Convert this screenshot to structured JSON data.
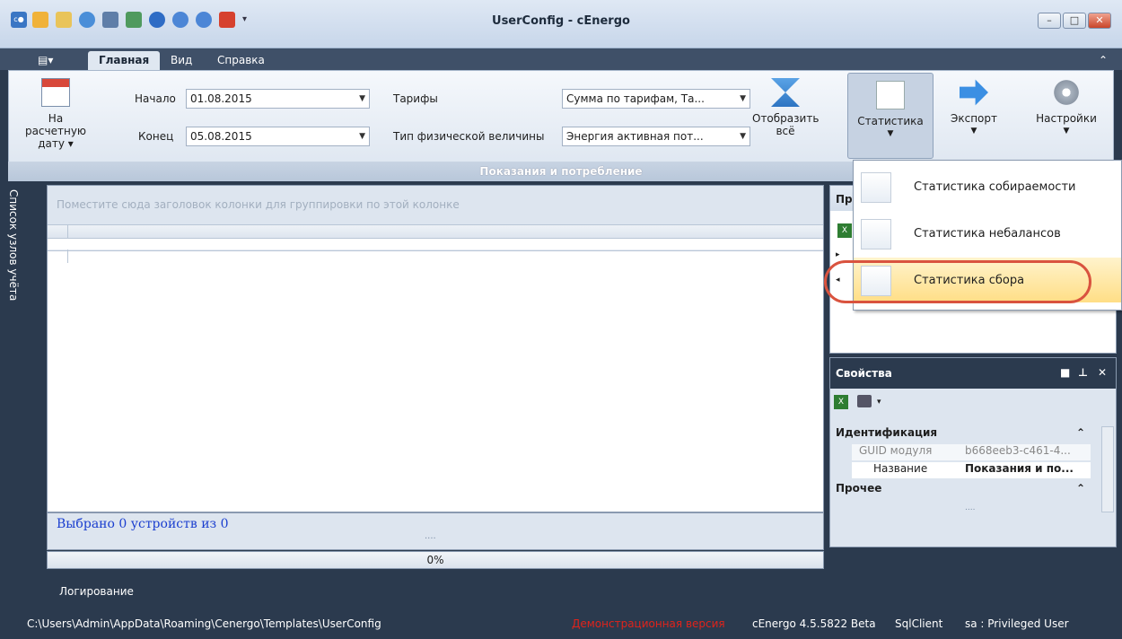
{
  "window": {
    "title": "UserConfig - cEnergo",
    "min": "–",
    "max": "□",
    "close": "✕"
  },
  "ribbon_tabs": [
    "Главная",
    "Вид",
    "Справка"
  ],
  "ribbon": {
    "date_button": "На расчетную дату ▾",
    "start_label": "Начало",
    "start_value": "01.08.2015",
    "end_label": "Конец",
    "end_value": "05.08.2015",
    "tariffs_label": "Тарифы",
    "tariffs_value": "Сумма по тарифам, Та...",
    "phys_label": "Тип физической величины",
    "phys_value": "Энергия активная пот...",
    "show_all": "Отобразить всё",
    "statistics": "Статистика",
    "export": "Экспорт",
    "settings": "Настройки",
    "caption": "Показания и потребление"
  },
  "left_vtab": "Список узлов учёта",
  "grid": {
    "group_hint": "Поместите сюда заголовок колонки для группировки по этой колонке",
    "selected": "Выбрано 0 устройств из 0",
    "gripper": "....",
    "progress": "0%"
  },
  "right_panel": {
    "header": "Пр"
  },
  "properties": {
    "header": "Свойства",
    "cat1": "Идентификация",
    "guid_label": "GUID модуля",
    "guid_value": "b668eeb3-c461-4...",
    "name_label": "Название",
    "name_value": "Показания и по...",
    "cat2": "Прочее",
    "gripper": "...."
  },
  "menu": {
    "items": [
      {
        "label": "Статистика собираемости"
      },
      {
        "label": "Статистика небалансов"
      },
      {
        "label": "Статистика сбора"
      }
    ]
  },
  "status": {
    "log": "Логирование",
    "path": "C:\\Users\\Admin\\AppData\\Roaming\\Cenergo\\Templates\\UserConfig",
    "demo": "Демонстрационная версия",
    "version": "cEnergo 4.5.5822 Beta",
    "db": "SqlClient",
    "user": "sa : Privileged User"
  },
  "colors": {
    "frame": "#2b3a4e",
    "demo_text": "#e0231b",
    "selected_text": "#1a3ecf",
    "highlight_ring": "#d9533f"
  }
}
